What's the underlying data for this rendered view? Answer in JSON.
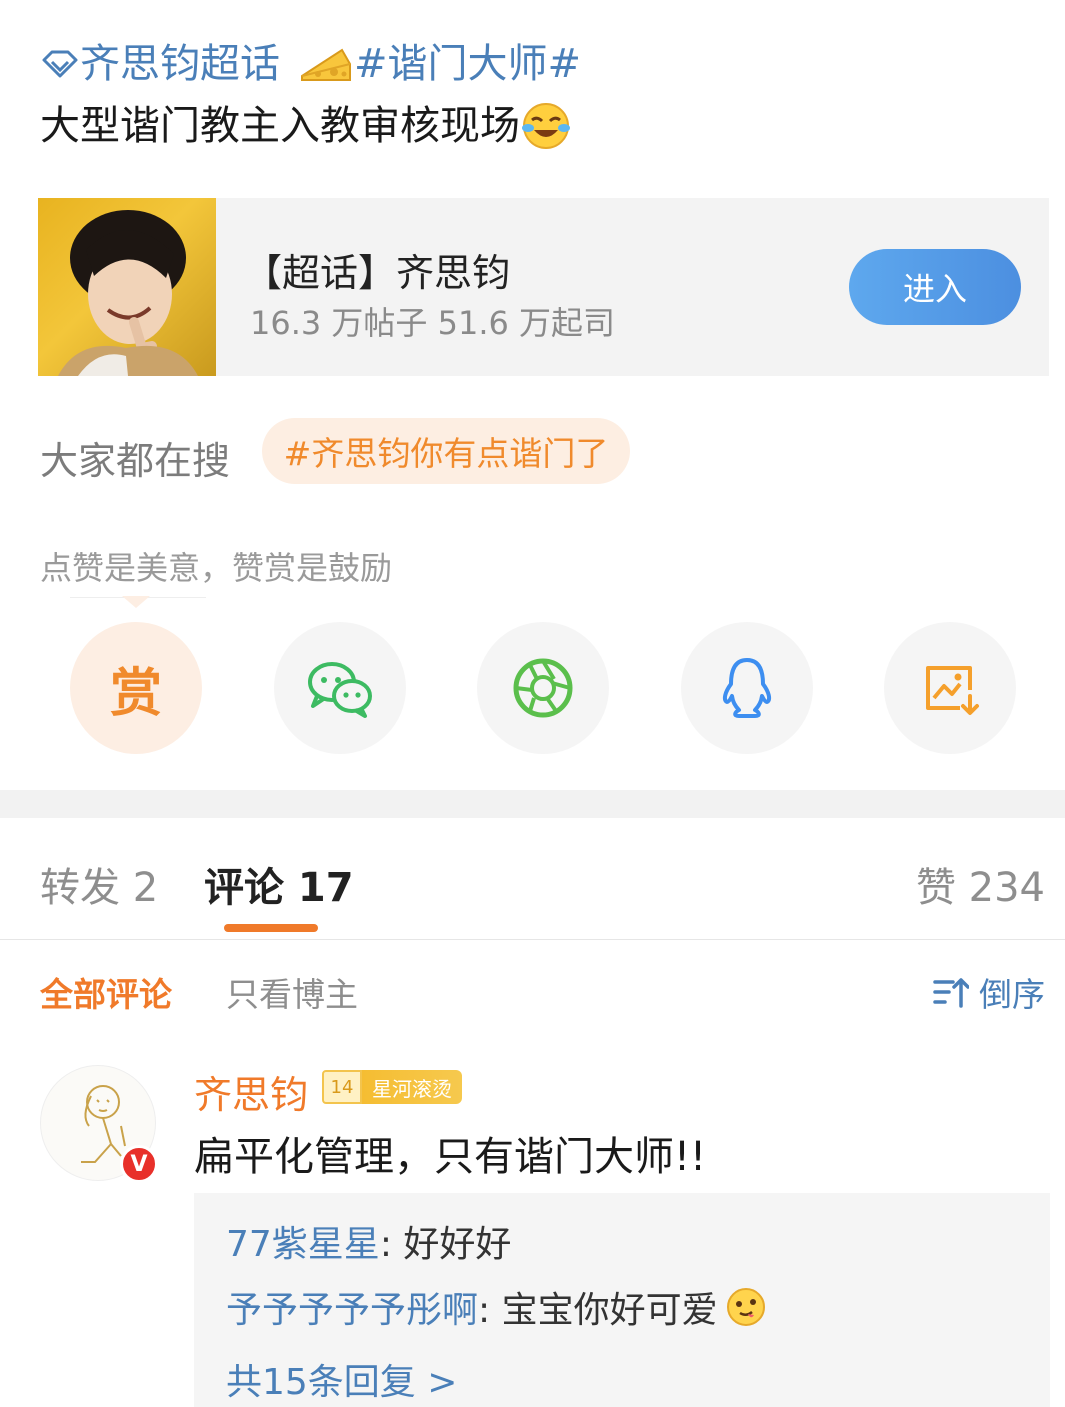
{
  "post": {
    "super_topic_link": "齐思钧超话",
    "hashtag": "#谐门大师#",
    "text": "大型谐门教主入教审核现场"
  },
  "topic_card": {
    "title": "【超话】齐思钧",
    "stats": "16.3 万帖子  51.6 万起司",
    "enter_label": "进入"
  },
  "search": {
    "label": "大家都在搜",
    "tag": "#齐思钧你有点谐门了"
  },
  "reward": {
    "prompt": "点赞是美意，赞赏是鼓励",
    "reward_label": "赏"
  },
  "tabs": {
    "repost": "转发 2",
    "comment": "评论 17",
    "like": "赞 234"
  },
  "filters": {
    "all": "全部评论",
    "owner_only": "只看博主",
    "sort": "倒序"
  },
  "comment": {
    "author": "齐思钧",
    "level": "14",
    "level_title": "星河滚烫",
    "verified": "V",
    "text": "扁平化管理，只有谐门大师!!",
    "replies": [
      {
        "user": "77紫星星",
        "text": ": 好好好"
      },
      {
        "user": "予予予予予彤啊",
        "text": ": 宝宝你好可爱"
      }
    ],
    "more_replies": "共15条回复 >"
  },
  "colors": {
    "link_blue": "#4a7fb8",
    "accent_orange": "#f07a2a",
    "button_blue": "#4c8fe0"
  }
}
